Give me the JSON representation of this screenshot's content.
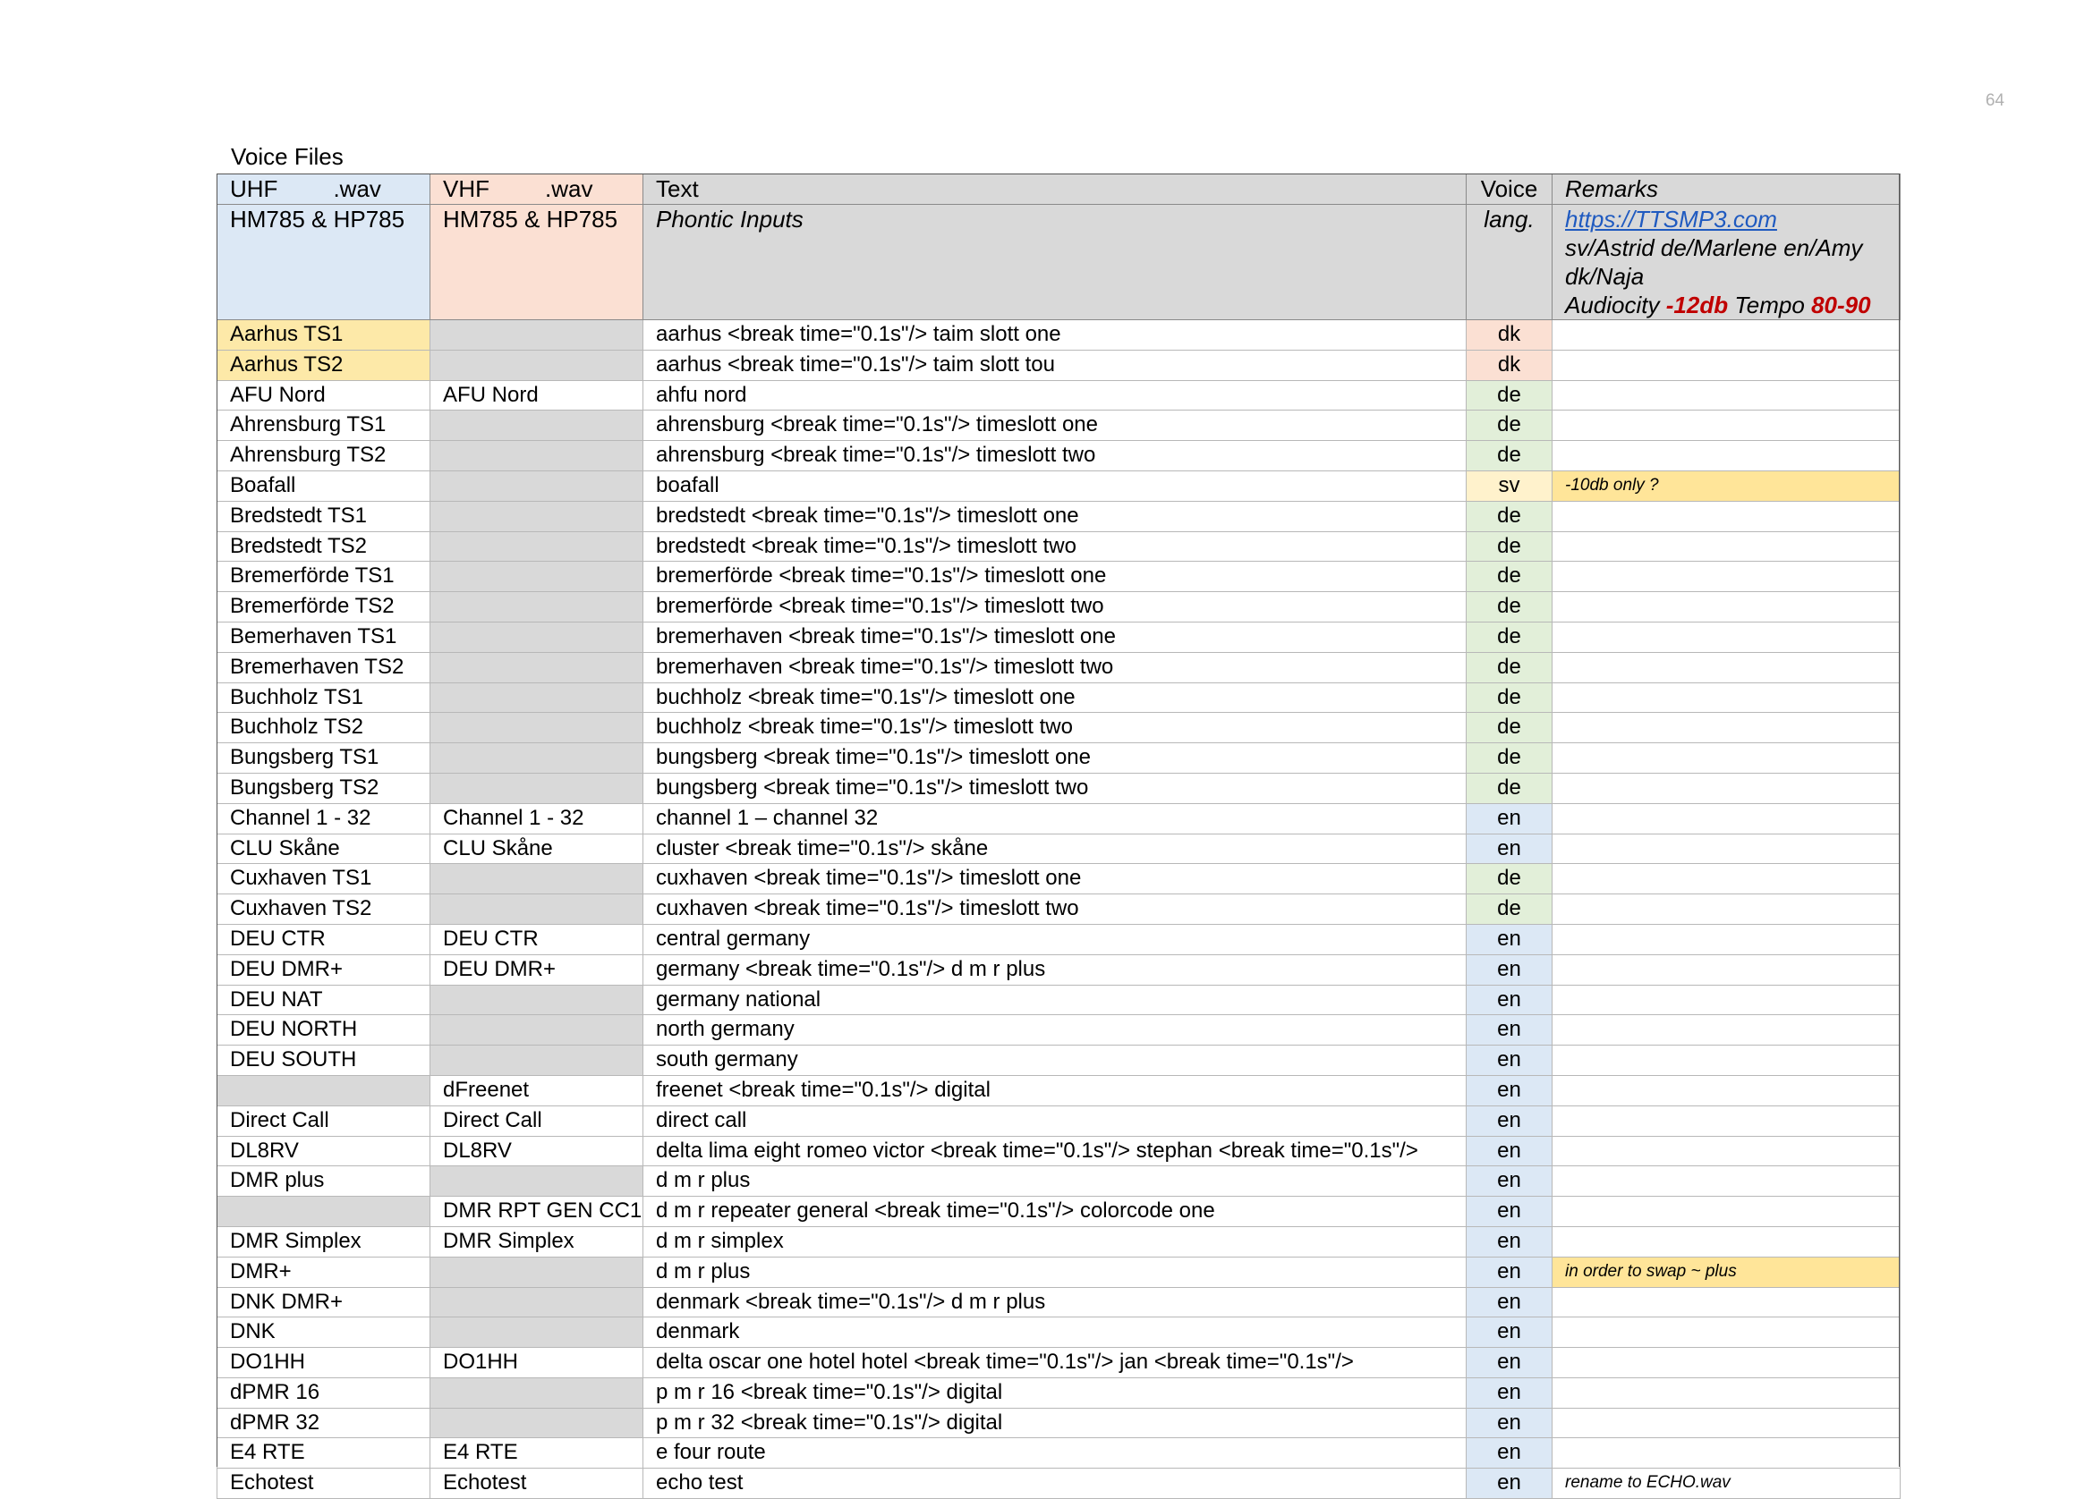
{
  "page_number": "64",
  "title": "Voice Files",
  "header": {
    "uhf_label": "UHF",
    "uhf_ext": ".wav",
    "vhf_label": "VHF",
    "vhf_ext": ".wav",
    "text_label": "Text",
    "voice_label": "Voice",
    "remarks_label": "Remarks",
    "uhf_models": "HM785 & HP785",
    "vhf_models": "HM785 & HP785",
    "phontic": "Phontic Inputs",
    "lang_label": "lang.",
    "remarks_link": "https://TTSMP3.com",
    "remarks_voices": "sv/Astrid de/Marlene en/Amy dk/Naja",
    "remarks_audiocity": "Audiocity",
    "remarks_db": "-12db",
    "remarks_tempo_label": "Tempo",
    "remarks_tempo": "80-90"
  },
  "colors": {
    "header_gray": "#d9d9d9",
    "uhf_blue": "#dce8f5",
    "vhf_peach": "#fbe0d3",
    "lang_de_green": "#e2efd9",
    "lang_en_blue": "#dce8f5",
    "lang_sv_yellow": "#fff2cc",
    "highlight_yellow": "#ffe599",
    "red_text": "#c00000"
  },
  "rows": [
    {
      "uhf": "Aarhus TS1",
      "vhf": "",
      "text": "aarhus <break time=\"0.1s\"/> taim slott one",
      "lang": "dk",
      "remark": "",
      "uhf_c": "yellow",
      "vhf_c": "gray",
      "rem_c": ""
    },
    {
      "uhf": "Aarhus TS2",
      "vhf": "",
      "text": "aarhus <break time=\"0.1s\"/> taim slott tou",
      "lang": "dk",
      "remark": "",
      "uhf_c": "yellow",
      "vhf_c": "gray",
      "rem_c": ""
    },
    {
      "uhf": "AFU Nord",
      "vhf": "AFU Nord",
      "text": "ahfu nord",
      "lang": "de",
      "remark": "",
      "uhf_c": "",
      "vhf_c": "",
      "rem_c": ""
    },
    {
      "uhf": "Ahrensburg TS1",
      "vhf": "",
      "text": "ahrensburg <break time=\"0.1s\"/> timeslott one",
      "lang": "de",
      "remark": "",
      "uhf_c": "",
      "vhf_c": "gray",
      "rem_c": ""
    },
    {
      "uhf": "Ahrensburg TS2",
      "vhf": "",
      "text": "ahrensburg <break time=\"0.1s\"/> timeslott two",
      "lang": "de",
      "remark": "",
      "uhf_c": "",
      "vhf_c": "gray",
      "rem_c": ""
    },
    {
      "uhf": "Boafall",
      "vhf": "",
      "text": "boafall",
      "lang": "sv",
      "remark": "-10db only ?",
      "uhf_c": "",
      "vhf_c": "gray",
      "rem_c": "yellow"
    },
    {
      "uhf": "Bredstedt TS1",
      "vhf": "",
      "text": "bredstedt <break time=\"0.1s\"/> timeslott one",
      "lang": "de",
      "remark": "",
      "uhf_c": "",
      "vhf_c": "gray",
      "rem_c": ""
    },
    {
      "uhf": "Bredstedt TS2",
      "vhf": "",
      "text": "bredstedt <break time=\"0.1s\"/> timeslott two",
      "lang": "de",
      "remark": "",
      "uhf_c": "",
      "vhf_c": "gray",
      "rem_c": ""
    },
    {
      "uhf": "Bremerförde TS1",
      "vhf": "",
      "text": "bremerförde <break time=\"0.1s\"/> timeslott one",
      "lang": "de",
      "remark": "",
      "uhf_c": "",
      "vhf_c": "gray",
      "rem_c": ""
    },
    {
      "uhf": "Bremerförde TS2",
      "vhf": "",
      "text": "bremerförde <break time=\"0.1s\"/> timeslott two",
      "lang": "de",
      "remark": "",
      "uhf_c": "",
      "vhf_c": "gray",
      "rem_c": ""
    },
    {
      "uhf": "Bemerhaven TS1",
      "vhf": "",
      "text": "bremerhaven <break time=\"0.1s\"/> timeslott one",
      "lang": "de",
      "remark": "",
      "uhf_c": "",
      "vhf_c": "gray",
      "rem_c": ""
    },
    {
      "uhf": "Bremerhaven TS2",
      "vhf": "",
      "text": "bremerhaven <break time=\"0.1s\"/> timeslott two",
      "lang": "de",
      "remark": "",
      "uhf_c": "",
      "vhf_c": "gray",
      "rem_c": ""
    },
    {
      "uhf": "Buchholz TS1",
      "vhf": "",
      "text": "buchholz <break time=\"0.1s\"/> timeslott one",
      "lang": "de",
      "remark": "",
      "uhf_c": "",
      "vhf_c": "gray",
      "rem_c": ""
    },
    {
      "uhf": "Buchholz TS2",
      "vhf": "",
      "text": "buchholz <break time=\"0.1s\"/> timeslott two",
      "lang": "de",
      "remark": "",
      "uhf_c": "",
      "vhf_c": "gray",
      "rem_c": ""
    },
    {
      "uhf": "Bungsberg TS1",
      "vhf": "",
      "text": "bungsberg <break time=\"0.1s\"/> timeslott one",
      "lang": "de",
      "remark": "",
      "uhf_c": "",
      "vhf_c": "gray",
      "rem_c": ""
    },
    {
      "uhf": "Bungsberg TS2",
      "vhf": "",
      "text": "bungsberg <break time=\"0.1s\"/> timeslott two",
      "lang": "de",
      "remark": "",
      "uhf_c": "",
      "vhf_c": "gray",
      "rem_c": ""
    },
    {
      "uhf": "Channel 1 - 32",
      "vhf": "Channel 1 - 32",
      "text": "channel 1 – channel 32",
      "lang": "en",
      "remark": "",
      "uhf_c": "",
      "vhf_c": "",
      "rem_c": ""
    },
    {
      "uhf": "CLU Skåne",
      "vhf": "CLU Skåne",
      "text": "cluster <break time=\"0.1s\"/> skåne",
      "lang": "en",
      "remark": "",
      "uhf_c": "",
      "vhf_c": "",
      "rem_c": ""
    },
    {
      "uhf": "Cuxhaven TS1",
      "vhf": "",
      "text": "cuxhaven <break time=\"0.1s\"/> timeslott one",
      "lang": "de",
      "remark": "",
      "uhf_c": "",
      "vhf_c": "gray",
      "rem_c": ""
    },
    {
      "uhf": "Cuxhaven TS2",
      "vhf": "",
      "text": "cuxhaven <break time=\"0.1s\"/> timeslott two",
      "lang": "de",
      "remark": "",
      "uhf_c": "",
      "vhf_c": "gray",
      "rem_c": ""
    },
    {
      "uhf": "DEU CTR",
      "vhf": "DEU CTR",
      "text": "central germany",
      "lang": "en",
      "remark": "",
      "uhf_c": "",
      "vhf_c": "",
      "rem_c": ""
    },
    {
      "uhf": "DEU DMR+",
      "vhf": "DEU DMR+",
      "text": "germany <break time=\"0.1s\"/>  d m r plus",
      "lang": "en",
      "remark": "",
      "uhf_c": "",
      "vhf_c": "",
      "rem_c": ""
    },
    {
      "uhf": "DEU NAT",
      "vhf": "",
      "text": "germany national",
      "lang": "en",
      "remark": "",
      "uhf_c": "",
      "vhf_c": "gray",
      "rem_c": ""
    },
    {
      "uhf": "DEU NORTH",
      "vhf": "",
      "text": "north germany",
      "lang": "en",
      "remark": "",
      "uhf_c": "",
      "vhf_c": "gray",
      "rem_c": ""
    },
    {
      "uhf": "DEU SOUTH",
      "vhf": "",
      "text": "south germany",
      "lang": "en",
      "remark": "",
      "uhf_c": "",
      "vhf_c": "gray",
      "rem_c": ""
    },
    {
      "uhf": "",
      "vhf": "dFreenet",
      "text": "freenet <break time=\"0.1s\"/> digital",
      "lang": "en",
      "remark": "",
      "uhf_c": "gray",
      "vhf_c": "",
      "rem_c": ""
    },
    {
      "uhf": "Direct Call",
      "vhf": "Direct Call",
      "text": "direct call",
      "lang": "en",
      "remark": "",
      "uhf_c": "",
      "vhf_c": "",
      "rem_c": ""
    },
    {
      "uhf": "DL8RV",
      "vhf": "DL8RV",
      "text": "delta lima eight romeo victor <break time=\"0.1s\"/> stephan <break time=\"0.1s\"/>",
      "lang": "en",
      "remark": "",
      "uhf_c": "",
      "vhf_c": "",
      "rem_c": ""
    },
    {
      "uhf": "DMR plus",
      "vhf": "",
      "text": "d m r plus",
      "lang": "en",
      "remark": "",
      "uhf_c": "",
      "vhf_c": "gray",
      "rem_c": ""
    },
    {
      "uhf": "",
      "vhf": "DMR RPT GEN CC1",
      "text": "d m r repeater general <break time=\"0.1s\"/> colorcode one",
      "lang": "en",
      "remark": "",
      "uhf_c": "gray",
      "vhf_c": "",
      "rem_c": ""
    },
    {
      "uhf": "DMR Simplex",
      "vhf": "DMR Simplex",
      "text": "d m r simplex",
      "lang": "en",
      "remark": "",
      "uhf_c": "",
      "vhf_c": "",
      "rem_c": ""
    },
    {
      "uhf": "DMR+",
      "vhf": "",
      "text": "d m r plus",
      "lang": "en",
      "remark": "in order to swap ~ plus",
      "uhf_c": "",
      "vhf_c": "gray",
      "rem_c": "yellow"
    },
    {
      "uhf": "DNK DMR+",
      "vhf": "",
      "text": "denmark <break time=\"0.1s\"/> d m r plus",
      "lang": "en",
      "remark": "",
      "uhf_c": "",
      "vhf_c": "gray",
      "rem_c": ""
    },
    {
      "uhf": "DNK",
      "vhf": "",
      "text": "denmark",
      "lang": "en",
      "remark": "",
      "uhf_c": "",
      "vhf_c": "gray",
      "rem_c": ""
    },
    {
      "uhf": "DO1HH",
      "vhf": "DO1HH",
      "text": "delta oscar one hotel hotel <break time=\"0.1s\"/> jan <break time=\"0.1s\"/>",
      "lang": "en",
      "remark": "",
      "uhf_c": "",
      "vhf_c": "",
      "rem_c": ""
    },
    {
      "uhf": "dPMR 16",
      "vhf": "",
      "text": "p m r 16 <break time=\"0.1s\"/> digital",
      "lang": "en",
      "remark": "",
      "uhf_c": "",
      "vhf_c": "gray",
      "rem_c": ""
    },
    {
      "uhf": "dPMR 32",
      "vhf": "",
      "text": "p m r 32 <break time=\"0.1s\"/> digital",
      "lang": "en",
      "remark": "",
      "uhf_c": "",
      "vhf_c": "gray",
      "rem_c": ""
    },
    {
      "uhf": "E4 RTE",
      "vhf": "E4 RTE",
      "text": "e four route",
      "lang": "en",
      "remark": "",
      "uhf_c": "",
      "vhf_c": "",
      "rem_c": ""
    },
    {
      "uhf": "Echotest",
      "vhf": "Echotest",
      "text": "echo test",
      "lang": "en",
      "remark": "rename to ECHO.wav",
      "uhf_c": "",
      "vhf_c": "",
      "rem_c": ""
    }
  ]
}
